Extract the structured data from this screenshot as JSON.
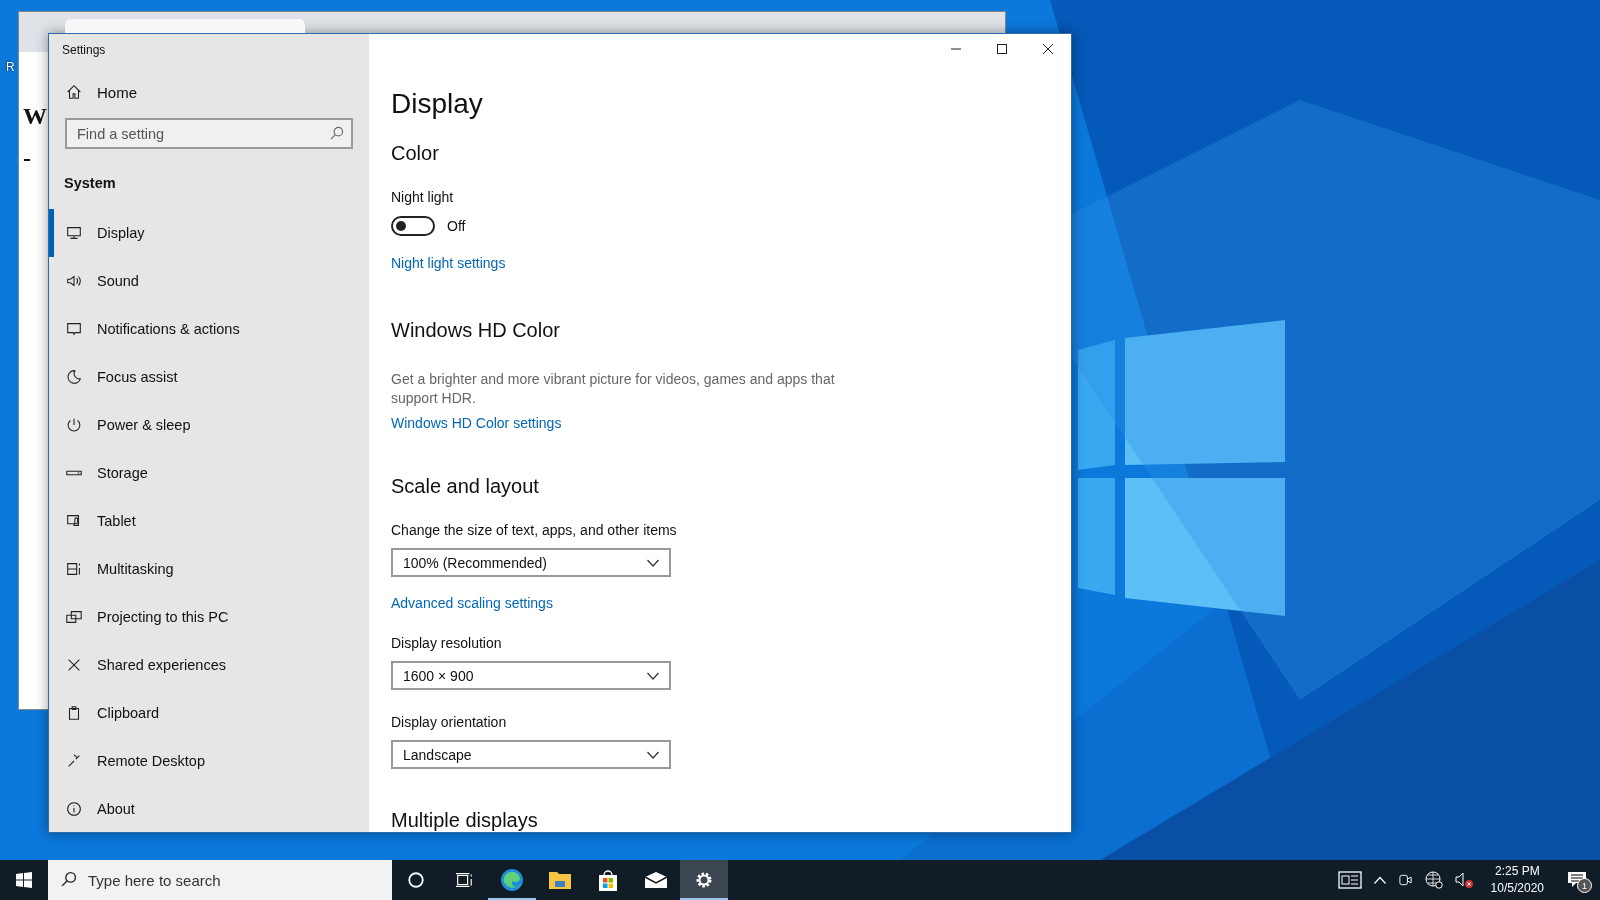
{
  "desktop": {
    "icon_label": "R"
  },
  "background_window": {
    "heading_fragments": [
      "W",
      "-"
    ]
  },
  "window": {
    "title": "Settings"
  },
  "sidebar": {
    "home": "Home",
    "search": {
      "placeholder": "Find a setting"
    },
    "section": "System",
    "items": [
      {
        "label": "Display",
        "selected": true
      },
      {
        "label": "Sound",
        "selected": false
      },
      {
        "label": "Notifications & actions",
        "selected": false
      },
      {
        "label": "Focus assist",
        "selected": false
      },
      {
        "label": "Power & sleep",
        "selected": false
      },
      {
        "label": "Storage",
        "selected": false
      },
      {
        "label": "Tablet",
        "selected": false
      },
      {
        "label": "Multitasking",
        "selected": false
      },
      {
        "label": "Projecting to this PC",
        "selected": false
      },
      {
        "label": "Shared experiences",
        "selected": false
      },
      {
        "label": "Clipboard",
        "selected": false
      },
      {
        "label": "Remote Desktop",
        "selected": false
      },
      {
        "label": "About",
        "selected": false
      }
    ]
  },
  "content": {
    "title": "Display",
    "color": {
      "heading": "Color",
      "night_light": {
        "label": "Night light",
        "on": false,
        "state_text": "Off"
      },
      "link": "Night light settings"
    },
    "hd_color": {
      "heading": "Windows HD Color",
      "description": "Get a brighter and more vibrant picture for videos, games and apps that support HDR.",
      "link": "Windows HD Color settings"
    },
    "scale": {
      "heading": "Scale and layout",
      "fields": [
        {
          "label": "Change the size of text, apps, and other items",
          "value": "100% (Recommended)",
          "link": "Advanced scaling settings"
        },
        {
          "label": "Display resolution",
          "value": "1600 × 900"
        },
        {
          "label": "Display orientation",
          "value": "Landscape"
        }
      ]
    },
    "next_heading": "Multiple displays"
  },
  "taskbar": {
    "search": {
      "placeholder": "Type here to search"
    },
    "apps": [
      {
        "running": false,
        "selected": false
      },
      {
        "running": false,
        "selected": false
      },
      {
        "running": true,
        "selected": false
      },
      {
        "running": false,
        "selected": false
      },
      {
        "running": false,
        "selected": false
      },
      {
        "running": false,
        "selected": false
      },
      {
        "running": true,
        "selected": true
      }
    ],
    "time": "2:25 PM",
    "date": "10/5/2020",
    "notification_count": "1"
  }
}
